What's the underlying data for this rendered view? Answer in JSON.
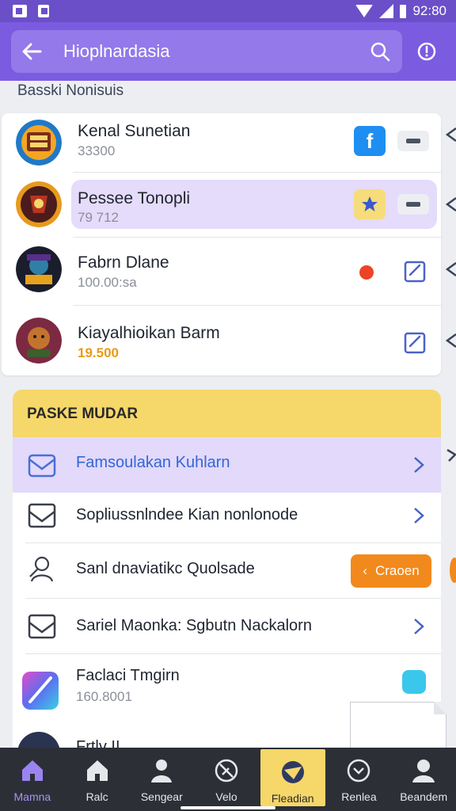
{
  "status_bar": {
    "time": "92:80"
  },
  "app_bar": {
    "title": "Hioplnardasia"
  },
  "section_label": "Basski Nonisuis",
  "contacts": [
    {
      "name": "Kenal Sunetian",
      "sub": "33300",
      "action": "facebook-icon"
    },
    {
      "name": "Pessee Tonopli",
      "sub": "79 712",
      "action": "star-icon"
    },
    {
      "name": "Fabrn Dlane",
      "sub": "100.00:sa",
      "action": "red-dot"
    },
    {
      "name": "Kiayalhioikan Barm",
      "sub": "19.500",
      "action": "edit-icon"
    }
  ],
  "package": {
    "title": "PASKE MUDAR",
    "rows": [
      {
        "label": "Famsoulakan Kuhlarn",
        "icon": "envelope-icon"
      },
      {
        "label": "Sopliussnlndee Kian nonlonode",
        "icon": "envelope-icon"
      },
      {
        "label": "Sanl dnaviatikc Quolsade",
        "icon": "person-icon",
        "button": "Craoen"
      },
      {
        "label": "Sariel Maonka: Sgbutn Nackalorn",
        "icon": "envelope-icon"
      },
      {
        "label": "Faclaci Tmgirn",
        "sub": "160.8001",
        "icon": "app-gradient-icon"
      }
    ],
    "partial_label": "Frtlv II"
  },
  "bottom_nav": [
    {
      "label": "Mamna",
      "icon": "home-icon"
    },
    {
      "label": "Ralc",
      "icon": "house-icon"
    },
    {
      "label": "Sengear",
      "icon": "person-icon"
    },
    {
      "label": "Velo",
      "icon": "slash-circle-icon"
    },
    {
      "label": "Fleadian",
      "icon": "compass-icon"
    },
    {
      "label": "Renlea",
      "icon": "chevron-circle-icon"
    },
    {
      "label": "Beandem",
      "icon": "profile-icon"
    }
  ],
  "colors": {
    "primary": "#7b5be0",
    "highlight": "#e5dbfb",
    "package_header": "#f6d76a",
    "accent_orange": "#f2891c",
    "nav_bg": "#2c2f36"
  }
}
